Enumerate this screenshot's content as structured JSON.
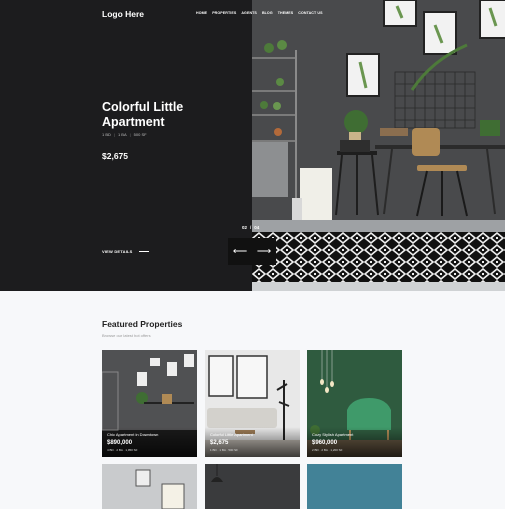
{
  "header": {
    "logo": "Logo Here",
    "nav": [
      "HOME",
      "PROPERTIES",
      "AGENTS",
      "BLOG",
      "THEMES",
      "CONTACT US"
    ]
  },
  "hero": {
    "title": "Colorful Little Apartment",
    "specs": [
      "1 BD",
      "1 BA",
      "500 SF"
    ],
    "price": "$2,675",
    "view_details": "VIEW DETAILS",
    "slide_current": "02",
    "slide_sep": "/",
    "slide_total": "04",
    "prev_arrow": "⟵",
    "next_arrow": "⟶"
  },
  "featured": {
    "title": "Featured Properties",
    "subtitle": "Browse our latest hot offers",
    "cards": [
      {
        "name": "Chic Apartment in Downtown",
        "price": "$890,000",
        "specs": "4 BD · 2 BA · 1,950 SF"
      },
      {
        "name": "Colorful Little Apartment",
        "price": "$2,675",
        "specs": "1 BD · 1 BA · 500 SF"
      },
      {
        "name": "Cozy Stylish Apartment",
        "price": "$960,000",
        "specs": "2 BD · 2 BA · 1,200 SF"
      }
    ]
  },
  "colors": {
    "dark_panel": "#1c1c1e",
    "page_bg": "#f7f8fa",
    "accent_green": "#2f5b3f"
  }
}
